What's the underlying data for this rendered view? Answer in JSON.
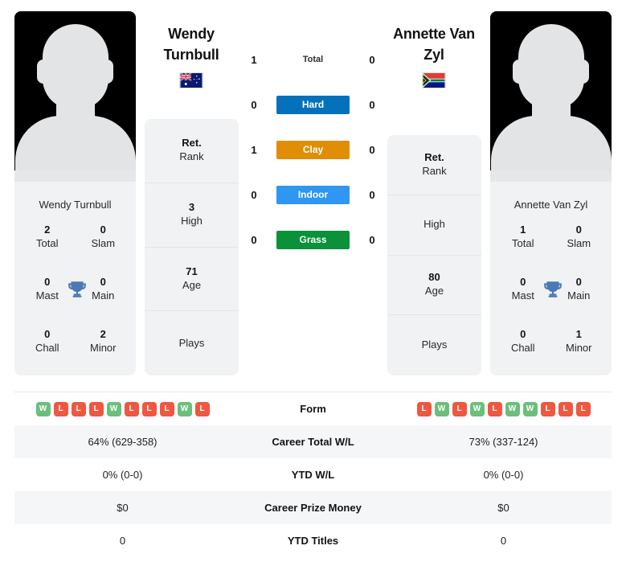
{
  "colors": {
    "hard": "#0671bb",
    "clay": "#df8e05",
    "indoor": "#2f96f2",
    "grass": "#0a9139",
    "win": "#6cbf7b",
    "loss": "#ef5740",
    "trophy": "#4a7ab5",
    "card_bg": "#f1f2f3",
    "row_alt": "#f5f6f7"
  },
  "players": {
    "left": {
      "name": "Wendy Turnbull",
      "name_line1": "Wendy",
      "name_line2": "Turnbull",
      "flag": "australia-flag",
      "flag_alt": "Australia",
      "photo": "player-silhouette-photo",
      "stats": [
        {
          "value": "2",
          "label": "Total"
        },
        {
          "value": "0",
          "label": "Slam"
        },
        {
          "value": "0",
          "label": "Mast"
        },
        {
          "value": "0",
          "label": "Main"
        },
        {
          "value": "0",
          "label": "Chall"
        },
        {
          "value": "2",
          "label": "Minor"
        }
      ],
      "trophy_icon": "trophy-icon",
      "rank": [
        {
          "value": "Ret.",
          "label": "Rank"
        },
        {
          "value": "3",
          "label": "High"
        },
        {
          "value": "71",
          "label": "Age"
        },
        {
          "value": "",
          "label": "Plays"
        }
      ]
    },
    "right": {
      "name": "Annette Van Zyl",
      "name_line1": "Annette Van",
      "name_line2": "Zyl",
      "flag": "south-africa-flag",
      "flag_alt": "South Africa",
      "photo": "player-silhouette-photo",
      "stats": [
        {
          "value": "1",
          "label": "Total"
        },
        {
          "value": "0",
          "label": "Slam"
        },
        {
          "value": "0",
          "label": "Mast"
        },
        {
          "value": "0",
          "label": "Main"
        },
        {
          "value": "0",
          "label": "Chall"
        },
        {
          "value": "1",
          "label": "Minor"
        }
      ],
      "trophy_icon": "trophy-icon",
      "rank": [
        {
          "value": "Ret.",
          "label": "Rank"
        },
        {
          "value": "",
          "label": "High"
        },
        {
          "value": "80",
          "label": "Age"
        },
        {
          "value": "",
          "label": "Plays"
        }
      ]
    }
  },
  "head_to_head": [
    {
      "label": "Total",
      "left": "1",
      "right": "0",
      "badge": false,
      "color": ""
    },
    {
      "label": "Hard",
      "left": "0",
      "right": "0",
      "badge": true,
      "color": "#0671bb"
    },
    {
      "label": "Clay",
      "left": "1",
      "right": "0",
      "badge": true,
      "color": "#df8e05"
    },
    {
      "label": "Indoor",
      "left": "0",
      "right": "0",
      "badge": true,
      "color": "#2f96f2"
    },
    {
      "label": "Grass",
      "left": "0",
      "right": "0",
      "badge": true,
      "color": "#0a9139"
    }
  ],
  "comparison_rows": [
    {
      "label": "Form",
      "type": "form",
      "left_form": [
        "W",
        "L",
        "L",
        "L",
        "W",
        "L",
        "L",
        "L",
        "W",
        "L"
      ],
      "right_form": [
        "L",
        "W",
        "L",
        "W",
        "L",
        "W",
        "W",
        "L",
        "L",
        "L"
      ],
      "left": "",
      "right": ""
    },
    {
      "label": "Career Total W/L",
      "type": "text",
      "left": "64% (629-358)",
      "right": "73% (337-124)"
    },
    {
      "label": "YTD W/L",
      "type": "text",
      "left": "0% (0-0)",
      "right": "0% (0-0)"
    },
    {
      "label": "Career Prize Money",
      "type": "text",
      "left": "$0",
      "right": "$0"
    },
    {
      "label": "YTD Titles",
      "type": "text",
      "left": "0",
      "right": "0"
    }
  ]
}
